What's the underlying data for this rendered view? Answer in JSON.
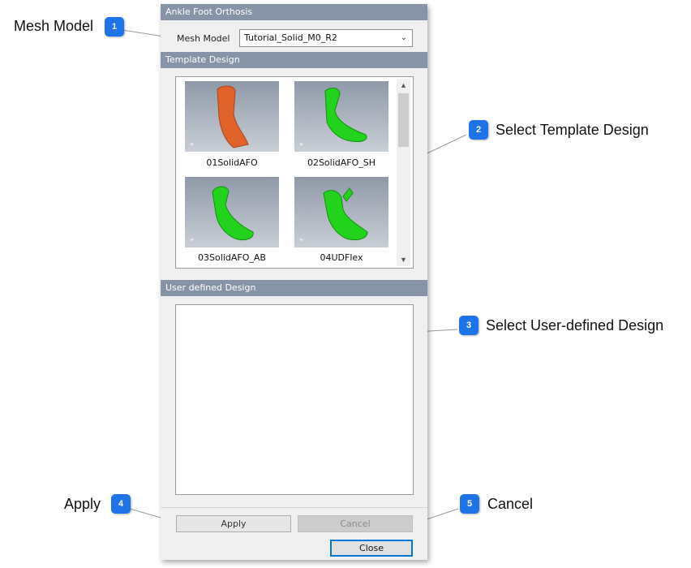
{
  "panel": {
    "title": "Ankle Foot Orthosis",
    "mesh_model_label": "Mesh Model",
    "mesh_model_value": "Tutorial_Solid_M0_R2",
    "template_header": "Template Design",
    "templates": [
      {
        "label": "01SolidAFO",
        "color": "#e0632b"
      },
      {
        "label": "02SolidAFO_SH",
        "color": "#22d21c"
      },
      {
        "label": "03SolidAFO_AB",
        "color": "#22d21c"
      },
      {
        "label": "04UDFlex",
        "color": "#22d21c"
      }
    ],
    "user_header": "User defined Design",
    "apply_label": "Apply",
    "cancel_label": "Cancel",
    "close_label": "Close"
  },
  "callouts": [
    {
      "number": "1",
      "text": "Mesh Model"
    },
    {
      "number": "2",
      "text": "Select Template Design"
    },
    {
      "number": "3",
      "text": "Select User-defined Design"
    },
    {
      "number": "4",
      "text": "Apply"
    },
    {
      "number": "5",
      "text": "Cancel"
    }
  ],
  "colors": {
    "badge": "#1e73e8",
    "header": "#8793a6",
    "focus": "#0078d7"
  }
}
